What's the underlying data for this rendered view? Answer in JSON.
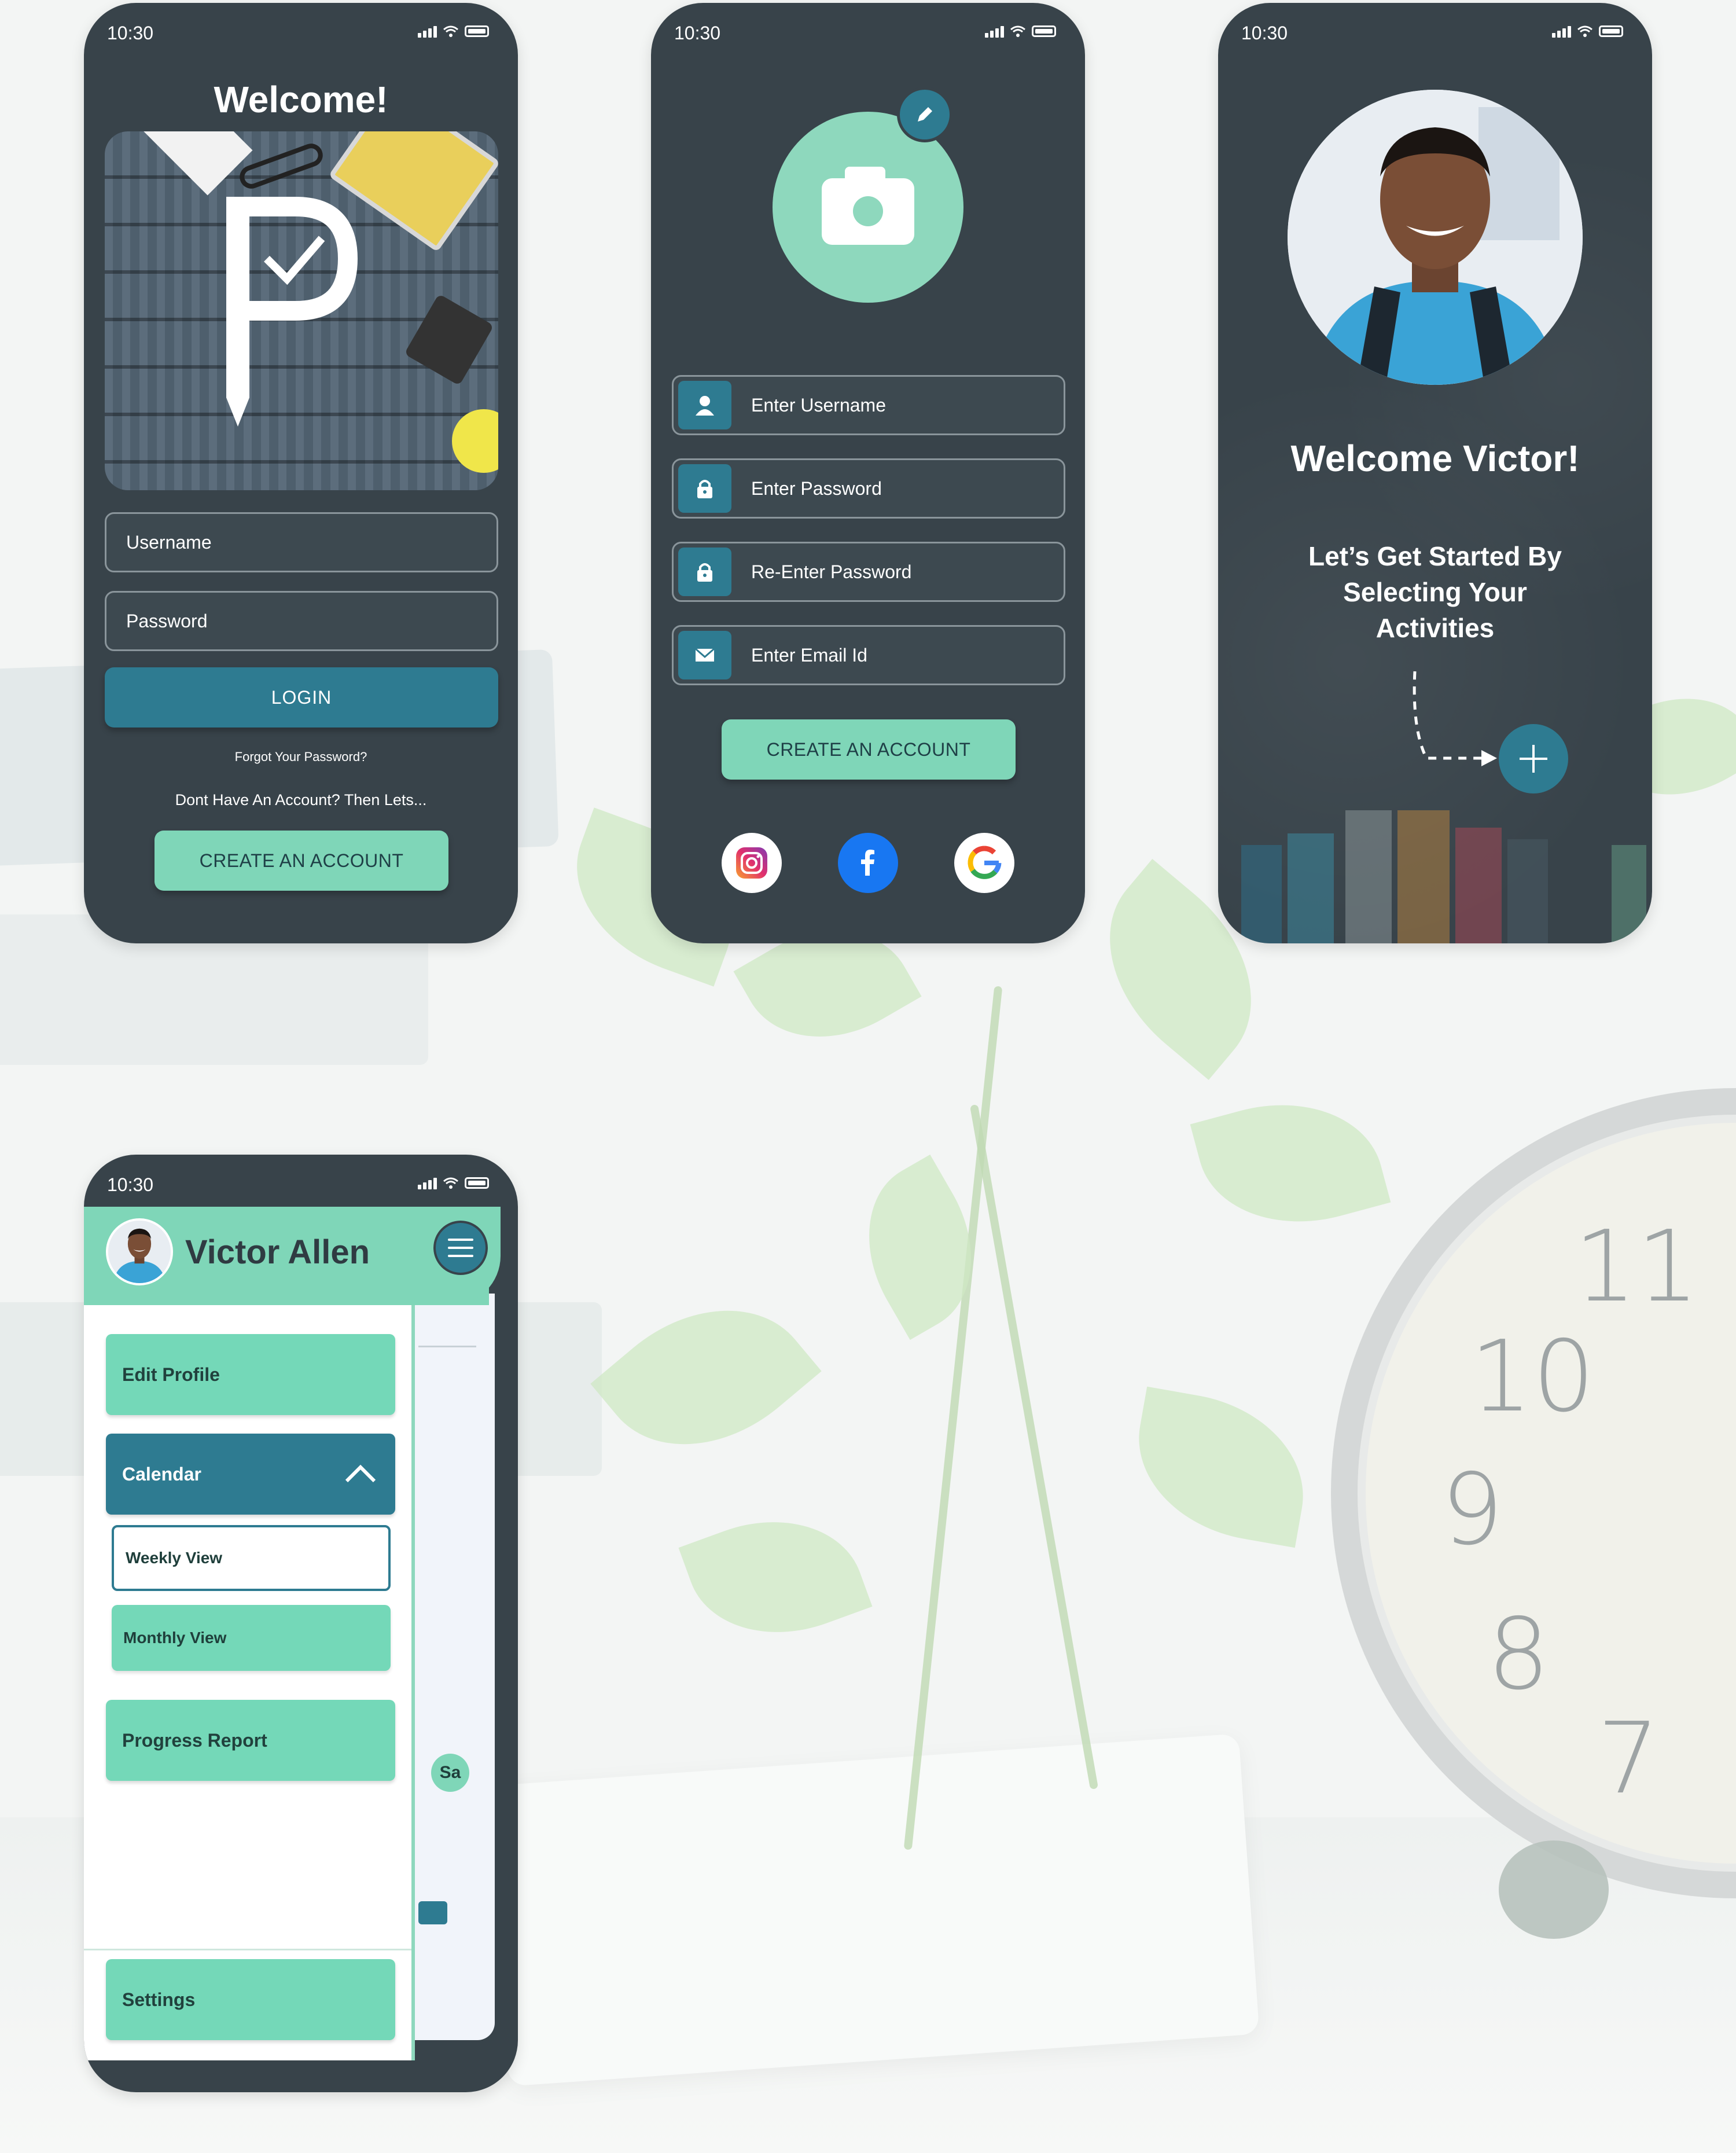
{
  "colors": {
    "phone_bg": "#38434a",
    "accent_teal": "#2e7b91",
    "accent_mint": "#7fd6b8",
    "text_light": "#ffffff",
    "text_dark": "#2f3b42"
  },
  "status_bar": {
    "time": "10:30"
  },
  "login_screen": {
    "title": "Welcome!",
    "username_placeholder": "Username",
    "password_placeholder": "Password",
    "login_label": "LOGIN",
    "forgot_label": "Forgot Your Password?",
    "no_account_text": "Dont Have An Account? Then Lets...",
    "create_account_label": "CREATE AN ACCOUNT"
  },
  "signup_screen": {
    "fields": [
      {
        "icon": "user-icon",
        "placeholder": "Enter Username"
      },
      {
        "icon": "lock-icon",
        "placeholder": "Enter Password"
      },
      {
        "icon": "lock-icon",
        "placeholder": "Re-Enter Password"
      },
      {
        "icon": "envelope-icon",
        "placeholder": "Enter Email Id"
      }
    ],
    "create_account_label": "CREATE AN ACCOUNT",
    "social": [
      "instagram-icon",
      "facebook-icon",
      "google-icon"
    ]
  },
  "welcome_screen": {
    "title": "Welcome Victor!",
    "subtitle": "Let’s Get Started By Selecting Your Activities"
  },
  "menu_screen": {
    "user_name": "Victor Allen",
    "items": {
      "edit_profile": "Edit Profile",
      "calendar": "Calendar",
      "weekly_view": "Weekly View",
      "monthly_view": "Monthly View",
      "progress_report": "Progress Report",
      "settings": "Settings"
    },
    "day_badge": "Sa"
  }
}
